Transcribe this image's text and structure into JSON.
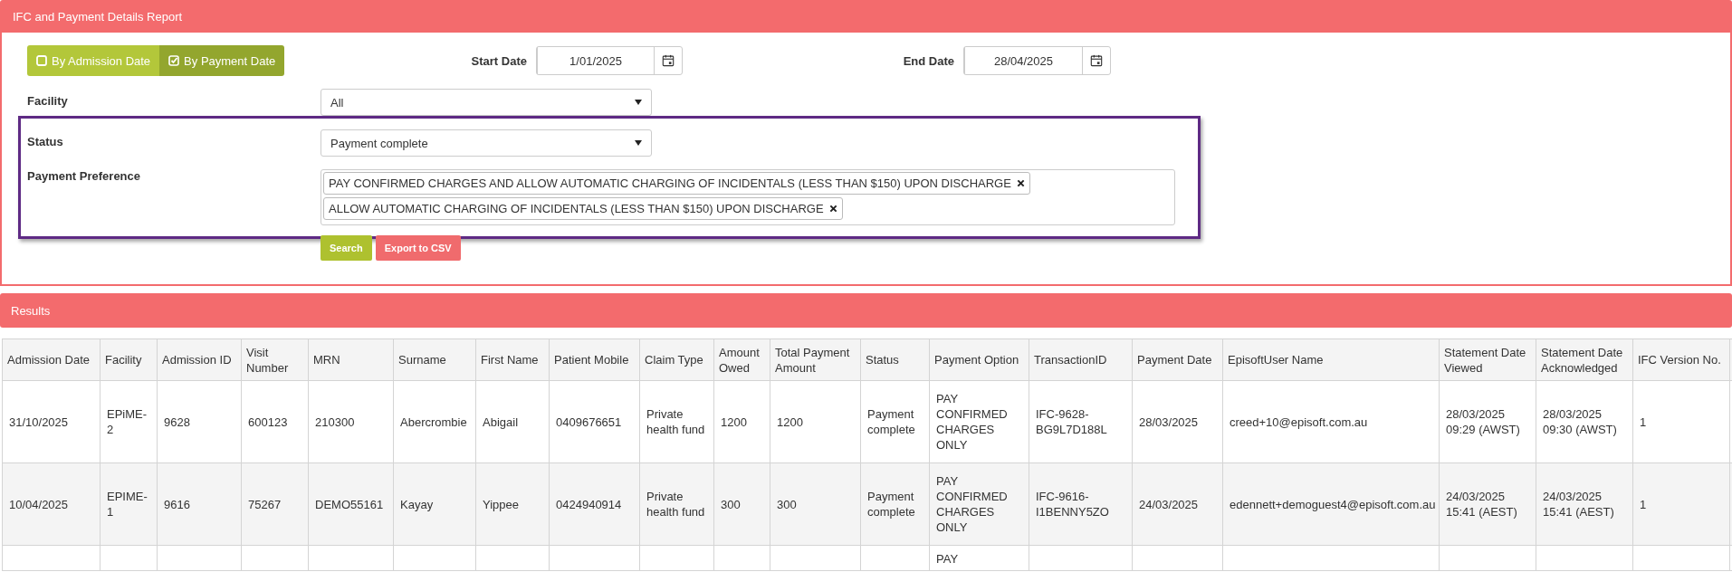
{
  "report_panel": {
    "title": "IFC and Payment Details Report"
  },
  "date_mode": [
    {
      "label": "By Admission Date",
      "selected": false
    },
    {
      "label": "By Payment Date",
      "selected": true
    }
  ],
  "start_date": {
    "label": "Start Date",
    "value": "1/01/2025"
  },
  "end_date": {
    "label": "End Date",
    "value": "28/04/2025"
  },
  "facility": {
    "label": "Facility",
    "value": "All"
  },
  "status": {
    "label": "Status",
    "value": "Payment complete"
  },
  "payment_preference": {
    "label": "Payment Preference",
    "tags": [
      "PAY CONFIRMED CHARGES AND ALLOW AUTOMATIC CHARGING OF INCIDENTALS (LESS THAN $150) UPON DISCHARGE",
      "ALLOW AUTOMATIC CHARGING OF INCIDENTALS (LESS THAN $150) UPON DISCHARGE"
    ]
  },
  "buttons": [
    {
      "label": "Search",
      "kind": "primary"
    },
    {
      "label": "Export to CSV",
      "kind": "export"
    }
  ],
  "results_panel": {
    "title": "Results"
  },
  "table": {
    "columns": [
      "Admission Date",
      "Facility",
      "Admission ID",
      "Visit Number",
      "MRN",
      "Surname",
      "First Name",
      "Patient Mobile",
      "Claim Type",
      "Amount Owed",
      "Total Payment Amount",
      "Status",
      "Payment Option",
      "TransactionID",
      "Payment Date",
      "EpisoftUser Name",
      "Statement Date Viewed",
      "Statement Date Acknowledged",
      "IFC Version No."
    ],
    "rows": [
      [
        "31/10/2025",
        "EPiME-2",
        "9628",
        "600123",
        "210300",
        "Abercrombie",
        "Abigail",
        "0409676651",
        "Private health fund",
        "1200",
        "1200",
        "Payment complete",
        "PAY CONFIRMED CHARGES ONLY",
        "IFC-9628-BG9L7D188L",
        "28/03/2025",
        "creed+10@episoft.com.au",
        "28/03/2025 09:29 (AWST)",
        "28/03/2025 09:30 (AWST)",
        "1"
      ],
      [
        "10/04/2025",
        "EPIME-1",
        "9616",
        "75267",
        "DEMO55161",
        "Kayay",
        "Yippee",
        "0424940914",
        "Private health fund",
        "300",
        "300",
        "Payment complete",
        "PAY CONFIRMED CHARGES ONLY",
        "IFC-9616-I1BENNY5ZO",
        "24/03/2025",
        "edennett+demoguest4@episoft.com.au",
        "24/03/2025 15:41 (AEST)",
        "24/03/2025 15:41 (AEST)",
        "1"
      ],
      [
        null,
        null,
        null,
        null,
        null,
        null,
        null,
        null,
        null,
        null,
        null,
        null,
        "PAY",
        null,
        null,
        null,
        null,
        null,
        null
      ]
    ]
  }
}
